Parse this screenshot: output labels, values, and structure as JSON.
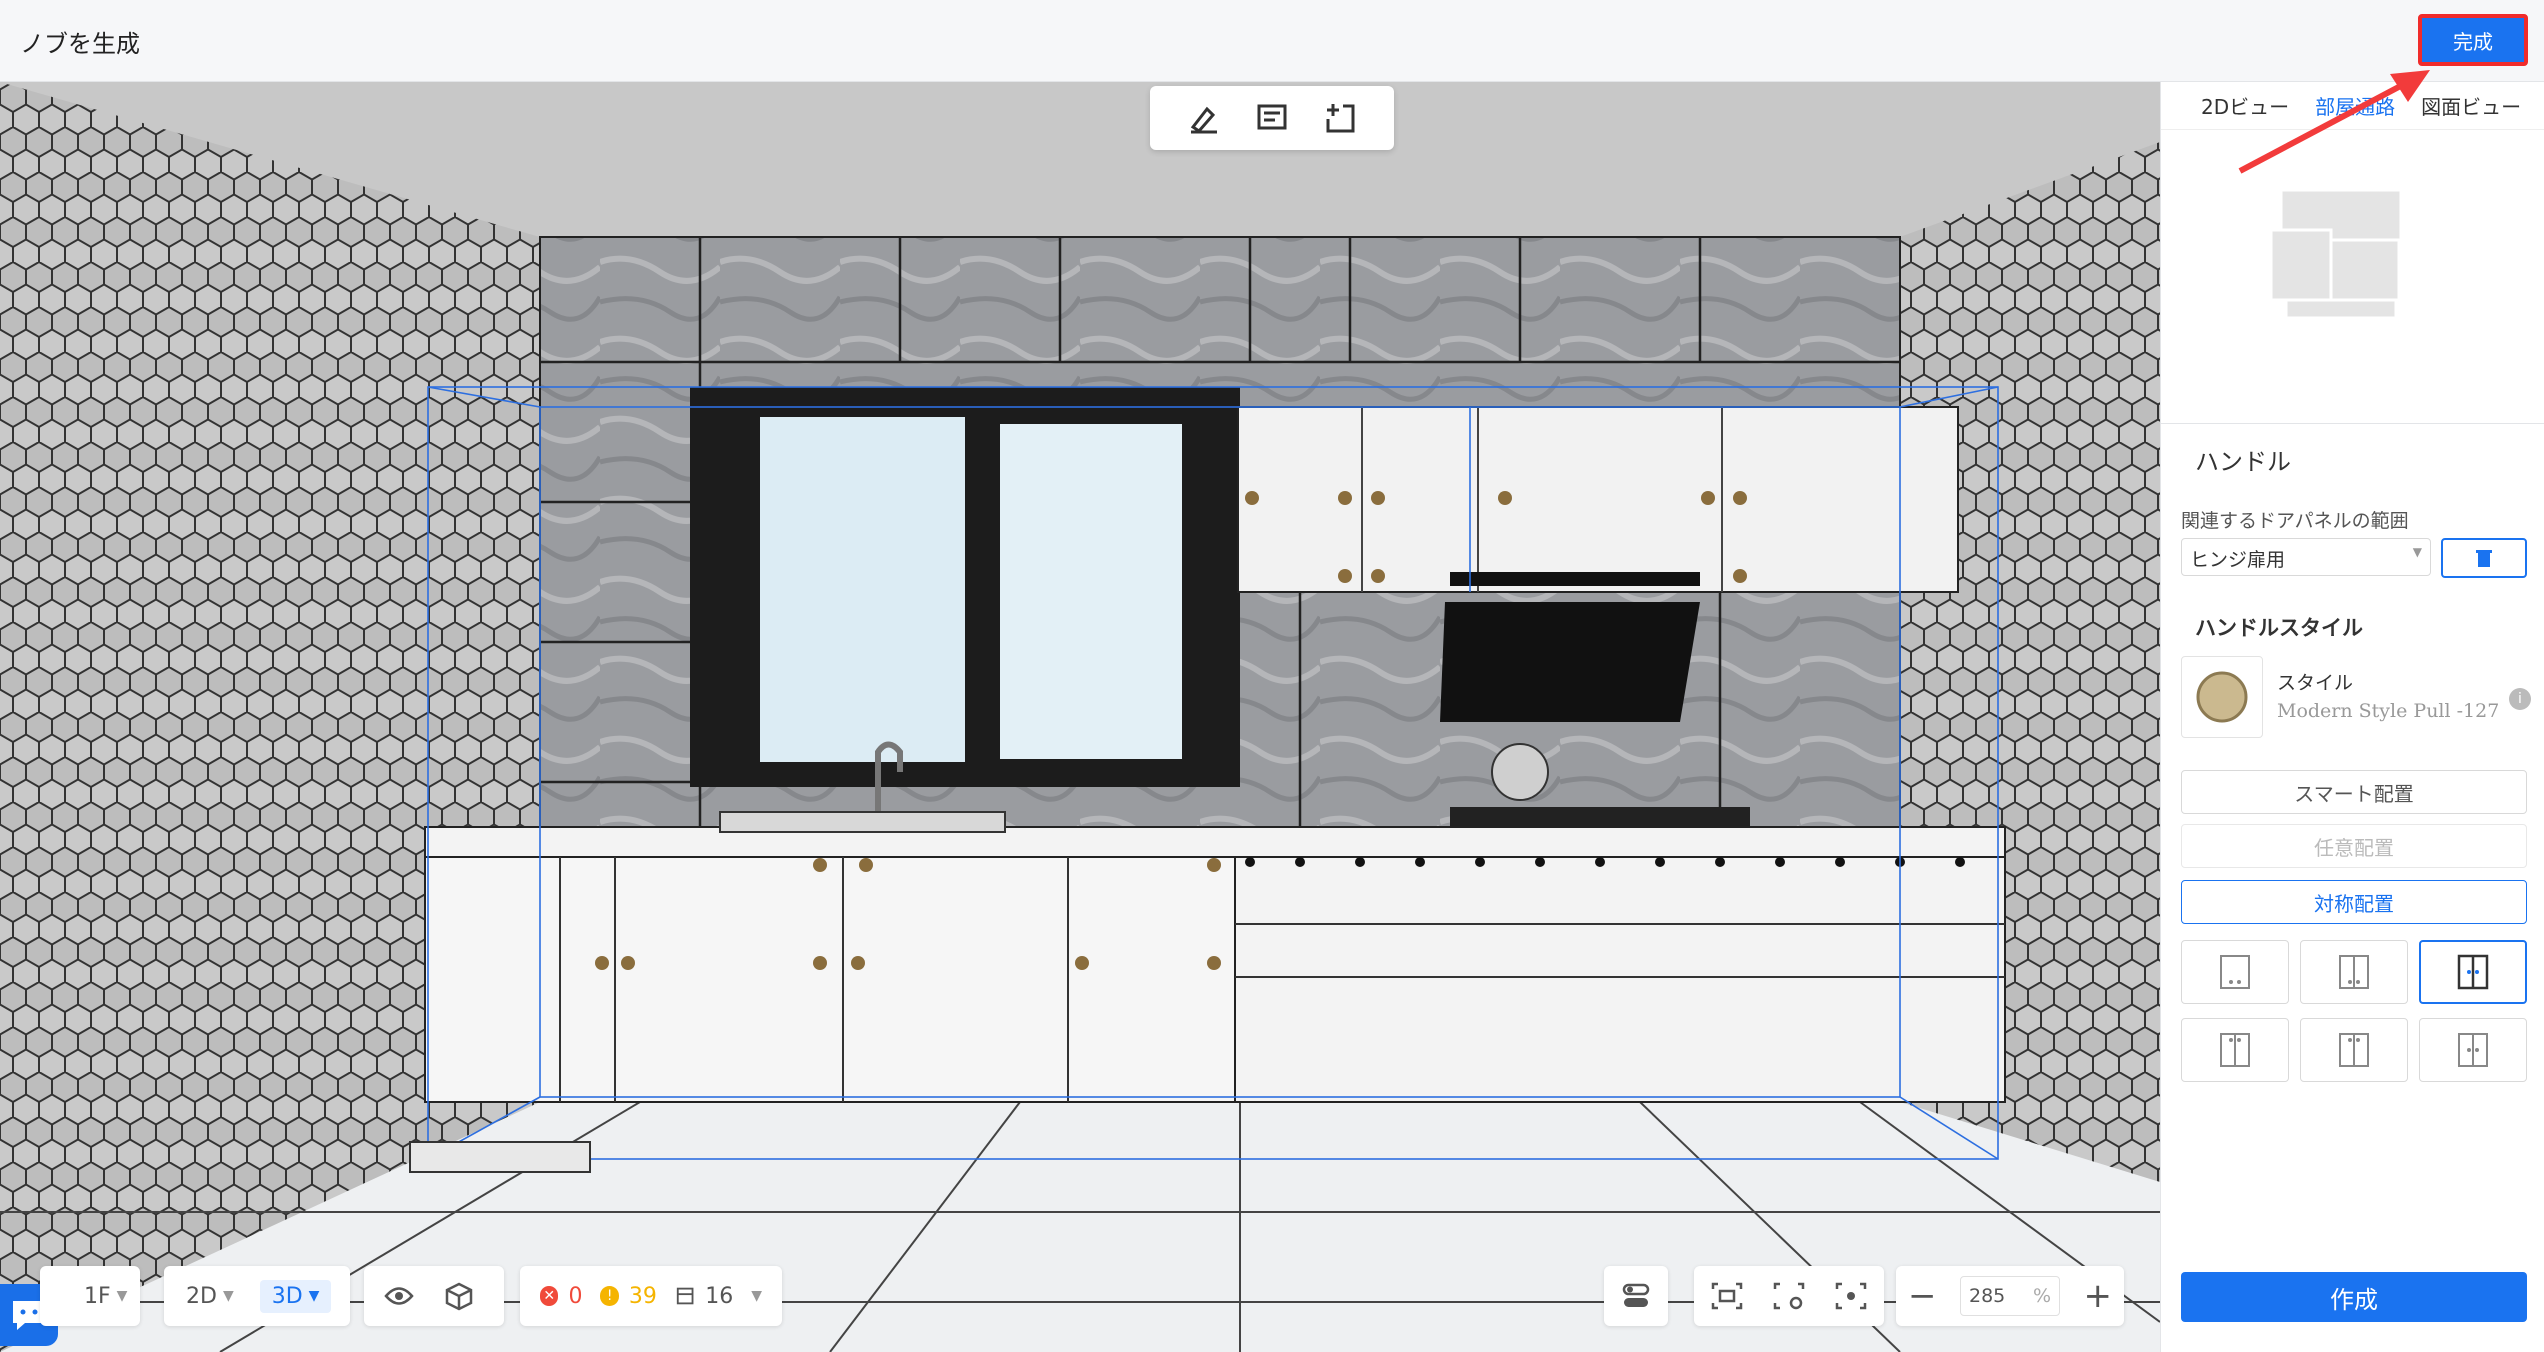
{
  "header": {
    "title": "ノブを生成",
    "done_label": "完成"
  },
  "panel": {
    "tabs": [
      {
        "label": "2Dビュー"
      },
      {
        "label": "部屋通路"
      },
      {
        "label": "図面ビュー"
      }
    ],
    "handle_title": "ハンドル",
    "range_label": "関連するドアパネルの範囲",
    "range_value": "ヒンジ扉用",
    "style_section": "ハンドルスタイル",
    "style_label": "スタイル",
    "style_value": "Modern Style Pull -127",
    "smart_label": "スマート配置",
    "free_label": "任意配置",
    "sym_label": "対称配置",
    "create_label": "作成"
  },
  "bottom": {
    "floor": "1F",
    "mode_2d": "2D",
    "mode_3d": "3D",
    "errors": "0",
    "warnings": "39",
    "items": "16",
    "zoom": "285",
    "zoom_unit": "%"
  },
  "colors": {
    "accent": "#1a73f0",
    "highlight": "#f02b2b",
    "error": "#f04a3a",
    "warning": "#f5b400"
  }
}
